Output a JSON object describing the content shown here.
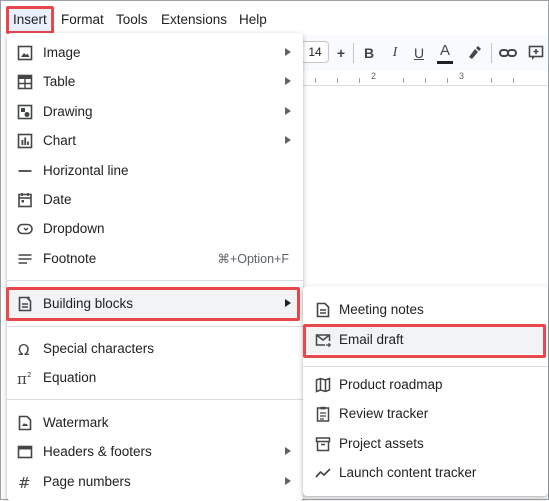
{
  "menubar": {
    "items": [
      "Insert",
      "Format",
      "Tools",
      "Extensions",
      "Help"
    ]
  },
  "toolbar": {
    "font_size": "14",
    "plus": "+",
    "bold": "B",
    "italic": "I",
    "underline": "U",
    "text_color": "A",
    "ruler_marks": [
      "2",
      "3"
    ]
  },
  "insert_menu": {
    "items": [
      {
        "label": "Image",
        "icon": "image-icon"
      },
      {
        "label": "Table",
        "icon": "table-icon"
      },
      {
        "label": "Drawing",
        "icon": "drawing-icon"
      },
      {
        "label": "Chart",
        "icon": "chart-icon"
      },
      {
        "label": "Horizontal line",
        "icon": "horizontal-line-icon"
      },
      {
        "label": "Date",
        "icon": "calendar-icon"
      },
      {
        "label": "Dropdown",
        "icon": "dropdown-icon"
      },
      {
        "label": "Footnote",
        "icon": "footnote-icon",
        "shortcut": "⌘+Option+F"
      },
      {
        "label": "Building blocks",
        "icon": "building-blocks-icon"
      },
      {
        "label": "Special characters",
        "icon": "omega-icon"
      },
      {
        "label": "Equation",
        "icon": "pi-icon"
      },
      {
        "label": "Watermark",
        "icon": "watermark-icon"
      },
      {
        "label": "Headers & footers",
        "icon": "header-footer-icon"
      },
      {
        "label": "Page numbers",
        "icon": "hash-icon"
      }
    ]
  },
  "building_blocks_menu": {
    "items": [
      {
        "label": "Meeting notes",
        "icon": "meeting-notes-icon"
      },
      {
        "label": "Email draft",
        "icon": "email-draft-icon"
      },
      {
        "label": "Product roadmap",
        "icon": "product-roadmap-icon"
      },
      {
        "label": "Review tracker",
        "icon": "review-tracker-icon"
      },
      {
        "label": "Project assets",
        "icon": "project-assets-icon"
      },
      {
        "label": "Launch content tracker",
        "icon": "launch-tracker-icon"
      }
    ]
  },
  "colors": {
    "highlight": "#e8474b",
    "hover": "#f1f3f4",
    "active_menu": "#e8f0fe"
  }
}
